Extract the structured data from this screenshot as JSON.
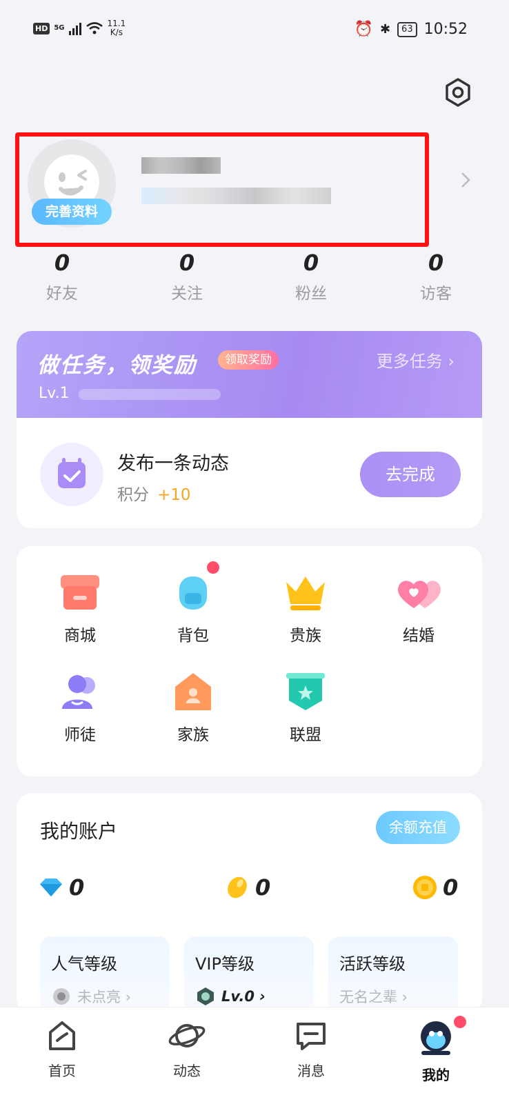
{
  "status_bar": {
    "network_badge": "HD",
    "signal": "5G",
    "speed": "11.1",
    "speed_unit": "K/s",
    "battery": "63",
    "time": "10:52"
  },
  "profile": {
    "complete_badge": "完善资料"
  },
  "stats": [
    {
      "value": "0",
      "label": "好友"
    },
    {
      "value": "0",
      "label": "关注"
    },
    {
      "value": "0",
      "label": "粉丝"
    },
    {
      "value": "0",
      "label": "访客"
    }
  ],
  "task": {
    "title": "做任务，领奖励",
    "tag": "领取奖励",
    "more": "更多任务 ›",
    "level": "Lv.1",
    "task_name": "发布一条动态",
    "score_label": "积分",
    "score_value": "+10",
    "button": "去完成"
  },
  "functions": [
    {
      "label": "商城",
      "icon": "shop-icon"
    },
    {
      "label": "背包",
      "icon": "backpack-icon"
    },
    {
      "label": "贵族",
      "icon": "crown-icon"
    },
    {
      "label": "结婚",
      "icon": "hearts-icon"
    },
    {
      "label": "师徒",
      "icon": "mentor-icon"
    },
    {
      "label": "家族",
      "icon": "family-icon"
    },
    {
      "label": "联盟",
      "icon": "alliance-shield-icon"
    }
  ],
  "account": {
    "title": "我的账户",
    "recharge": "余额充值",
    "balances": [
      {
        "icon": "diamond-icon",
        "value": "0"
      },
      {
        "icon": "bean-icon",
        "value": "0"
      },
      {
        "icon": "coin-icon",
        "value": "0"
      }
    ],
    "levels": [
      {
        "title": "人气等级",
        "sub": "未点亮 ›"
      },
      {
        "title": "VIP等级",
        "sub": "Lv.0 ›"
      },
      {
        "title": "活跃等级",
        "sub": "无名之辈 ›"
      }
    ]
  },
  "tabs": [
    {
      "label": "首页"
    },
    {
      "label": "动态"
    },
    {
      "label": "消息"
    },
    {
      "label": "我的"
    }
  ],
  "colors": {
    "accent_purple": "#a68af2",
    "highlight_red": "#ff1111",
    "score_orange": "#f5a623"
  }
}
